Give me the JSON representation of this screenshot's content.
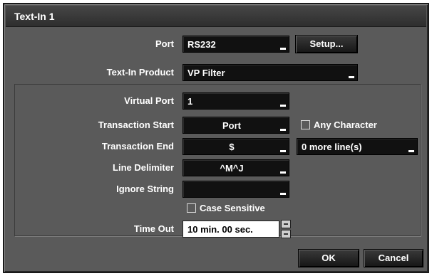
{
  "dialog": {
    "title": "Text-In 1"
  },
  "port": {
    "label": "Port",
    "value": "RS232",
    "setup_label": "Setup..."
  },
  "text_in_product": {
    "label": "Text-In Product",
    "value": "VP Filter"
  },
  "virtual_port": {
    "label": "Virtual Port",
    "value": "1"
  },
  "transaction_start": {
    "label": "Transaction Start",
    "value": "Port",
    "any_character_label": "Any Character",
    "any_character_checked": false
  },
  "transaction_end": {
    "label": "Transaction End",
    "value": "$",
    "more_lines_value": "0 more line(s)"
  },
  "line_delimiter": {
    "label": "Line Delimiter",
    "value": "^M^J"
  },
  "ignore_string": {
    "label": "Ignore String",
    "value": ""
  },
  "case_sensitive": {
    "label": "Case Sensitive",
    "checked": false
  },
  "time_out": {
    "label": "Time Out",
    "value": "10 min. 00 sec."
  },
  "buttons": {
    "ok_label": "OK",
    "cancel_label": "Cancel"
  }
}
